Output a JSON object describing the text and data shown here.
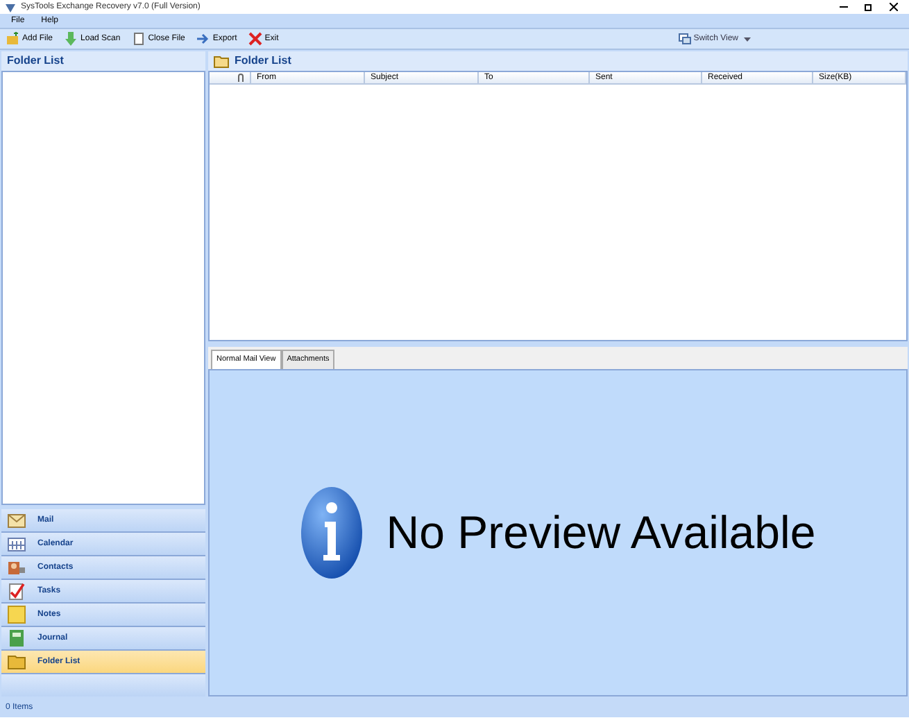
{
  "window": {
    "title": "SysTools Exchange Recovery v7.0 (Full Version)"
  },
  "menu": [
    "File",
    "Help"
  ],
  "toolbar": [
    {
      "kind": "add",
      "label": "Add File"
    },
    {
      "kind": "load",
      "label": "Load Scan"
    },
    {
      "kind": "close",
      "label": "Close File"
    },
    {
      "kind": "export",
      "label": "Export"
    },
    {
      "kind": "exit",
      "label": "Exit"
    }
  ],
  "switch_view": "Switch View",
  "left_panel": {
    "title": "Folder List"
  },
  "nav": [
    {
      "kind": "mail",
      "label": "Mail",
      "selected": false
    },
    {
      "kind": "calendar",
      "label": "Calendar",
      "selected": false
    },
    {
      "kind": "contacts",
      "label": "Contacts",
      "selected": false
    },
    {
      "kind": "tasks",
      "label": "Tasks",
      "selected": false
    },
    {
      "kind": "notes",
      "label": "Notes",
      "selected": false
    },
    {
      "kind": "journal",
      "label": "Journal",
      "selected": false
    },
    {
      "kind": "folder",
      "label": "Folder List",
      "selected": true
    }
  ],
  "list": {
    "title": "Folder List",
    "columns": [
      "From",
      "Subject",
      "To",
      "Sent",
      "Received",
      "Size(KB)"
    ]
  },
  "tabs": [
    {
      "label": "Normal Mail View",
      "selected": true
    },
    {
      "label": "Attachments",
      "selected": false
    }
  ],
  "preview": {
    "message": "No Preview Available"
  },
  "status_bar": "0 Items"
}
